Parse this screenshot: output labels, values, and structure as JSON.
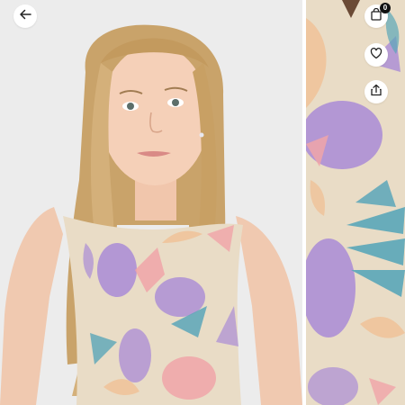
{
  "header": {
    "back_icon": "arrow-left-icon",
    "bag_icon": "shopping-bag-icon",
    "bag_count": "0",
    "wishlist_icon": "heart-icon",
    "share_icon": "share-icon"
  },
  "gallery": {
    "images": [
      {
        "subject": "girl-wearing-floral-sleeveless-top"
      },
      {
        "subject": "floral-fabric-closeup"
      }
    ]
  },
  "colors": {
    "background": "#ececec",
    "fabric_base": "#e9dcc6",
    "lilac": "#a98bd6",
    "teal": "#5aa6b8",
    "pink": "#f0a4a8",
    "peach": "#efc39a",
    "icon": "#222222"
  }
}
